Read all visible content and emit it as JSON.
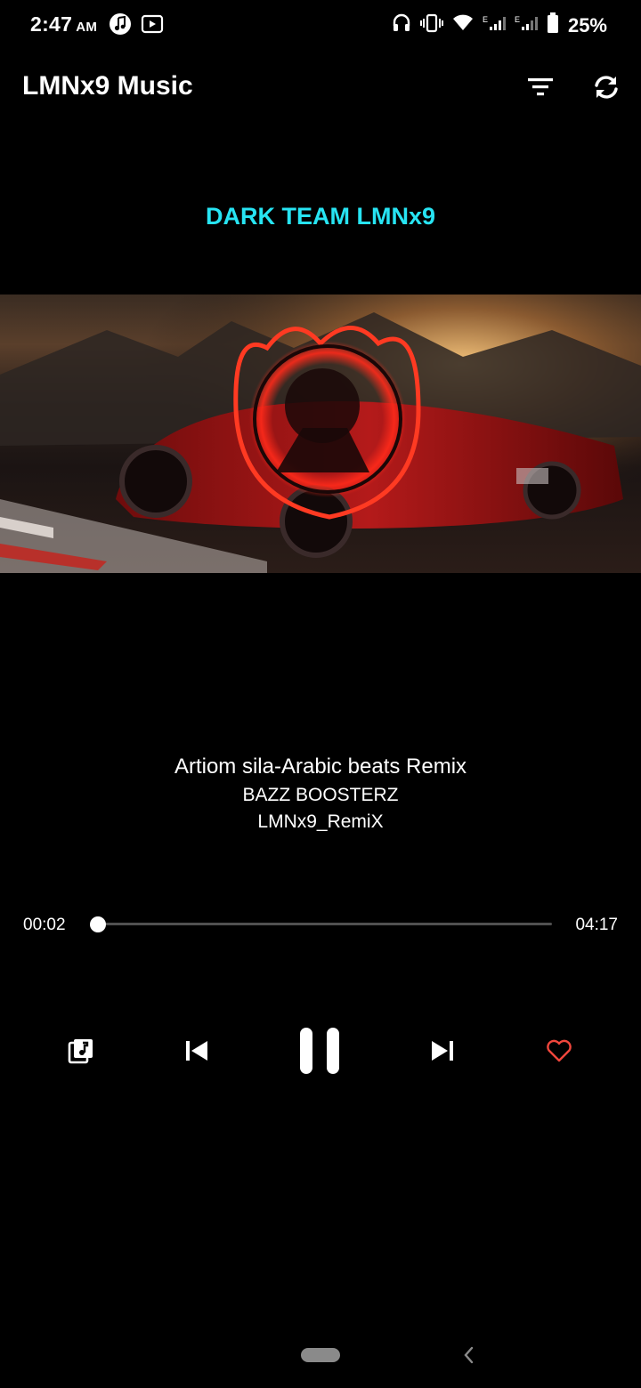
{
  "status_bar": {
    "time": "2:47",
    "ampm": "AM",
    "left_icons": [
      "music-note-icon",
      "youtube-icon"
    ],
    "right_icons": [
      "headphones-icon",
      "vibrate-icon",
      "wifi-icon",
      "signal-e-icon",
      "signal-e-icon"
    ],
    "battery": "25%"
  },
  "app_bar": {
    "title": "LMNx9 Music",
    "actions": [
      "filter-icon",
      "sync-icon"
    ]
  },
  "banner": {
    "text": "DARK TEAM LMNx9",
    "color": "#27e4f3"
  },
  "now_playing": {
    "title": "Artiom sila-Arabic beats Remix",
    "artist": "BAZZ BOOSTERZ",
    "album": "LMNx9_RemiX",
    "elapsed": "00:02",
    "duration": "04:17",
    "progress_fraction": 0.008
  },
  "controls": {
    "icons": [
      "playlist-icon",
      "previous-icon",
      "pause-icon",
      "next-icon",
      "heart-icon"
    ],
    "favorite_color": "#f0463c"
  }
}
